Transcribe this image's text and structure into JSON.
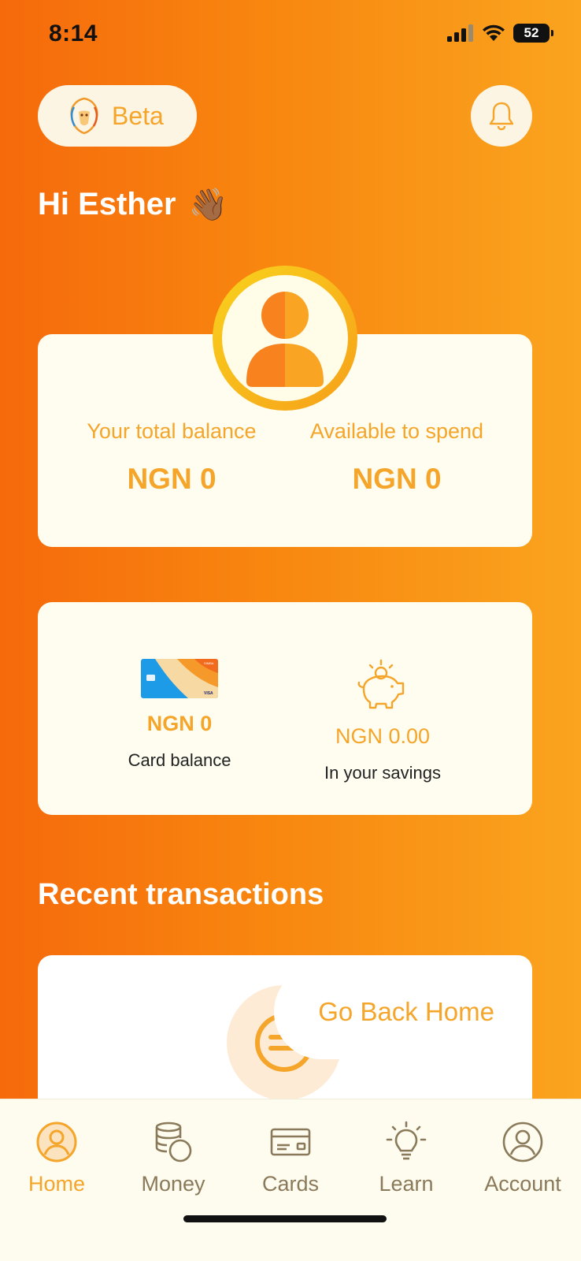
{
  "status_bar": {
    "time": "8:14",
    "battery": "52"
  },
  "header": {
    "beta_label": "Beta"
  },
  "greeting": {
    "text": "Hi Esther",
    "emoji": "👋🏾"
  },
  "balances": {
    "total_label": "Your total balance",
    "total_value": "NGN 0",
    "available_label": "Available to spend",
    "available_value": "NGN 0"
  },
  "summary": {
    "card_value": "NGN 0",
    "card_label": "Card balance",
    "savings_value": "NGN 0.00",
    "savings_label": "In your savings",
    "card_brand": "SIMBA",
    "card_network": "VISA"
  },
  "recent": {
    "title": "Recent transactions",
    "go_home_label": "Go Back Home"
  },
  "tabs": [
    {
      "label": "Home",
      "icon": "home-icon",
      "active": true
    },
    {
      "label": "Money",
      "icon": "coins-icon",
      "active": false
    },
    {
      "label": "Cards",
      "icon": "card-icon",
      "active": false
    },
    {
      "label": "Learn",
      "icon": "bulb-icon",
      "active": false
    },
    {
      "label": "Account",
      "icon": "account-icon",
      "active": false
    }
  ],
  "colors": {
    "accent": "#f4a52a",
    "gradient_start": "#f66a0c",
    "gradient_end": "#faa41f",
    "card_bg": "#fffdf0",
    "tab_inactive": "#8a7a5a"
  }
}
